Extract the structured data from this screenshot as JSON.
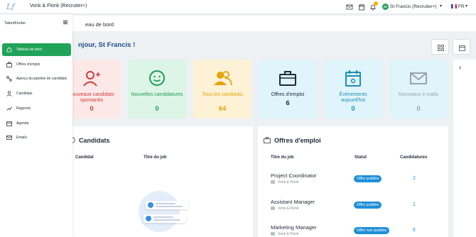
{
  "topbar": {
    "logo": "Lf",
    "company": "Vonk & Flonk (Recruiter+)",
    "notif_count": "10",
    "avatar_initials": "SF",
    "user": "St Francis (Recruiter+)",
    "lang": "FR",
    "icons": [
      "mail-icon",
      "calendar-icon",
      "bell-icon",
      "chevron-down-icon"
    ]
  },
  "sidebar": {
    "brand": "TalentFinder",
    "items": [
      {
        "label": "Tableau de bord",
        "icon": "home-icon",
        "active": true
      },
      {
        "label": "Offres d'emploi",
        "icon": "briefcase-icon",
        "active": false
      },
      {
        "label": "Aperçu du pipeline de candidats",
        "icon": "pipeline-icon",
        "active": false
      },
      {
        "label": "Candidats",
        "icon": "users-icon",
        "active": false
      },
      {
        "label": "Rapports",
        "icon": "chart-icon",
        "active": false
      },
      {
        "label": "Agenda",
        "icon": "calendar-icon",
        "active": false
      },
      {
        "label": "Emails",
        "icon": "mail-icon",
        "active": false
      }
    ]
  },
  "page": {
    "title": "eau de bord",
    "welcome": "njour, St Francis !"
  },
  "stats": [
    {
      "label": "Nouveaux candidats spontanés",
      "value": "0",
      "icon": "user-plus-icon",
      "color": "#d23b3b",
      "bg": "#fde8e8"
    },
    {
      "label": "Nouvelles candidatures",
      "value": "0",
      "icon": "smiley-icon",
      "color": "#1f9a55",
      "bg": "#dcf5e7"
    },
    {
      "label": "Tous les candidats",
      "value": "64",
      "icon": "users-icon",
      "color": "#e5a50a",
      "bg": "#fdf1d6"
    },
    {
      "label": "Offres d'emploi",
      "value": "6",
      "icon": "briefcase-icon",
      "color": "#1f2a37",
      "bg": "#dff4fb"
    },
    {
      "label": "Événements aujourd'hui",
      "value": "0",
      "icon": "calendar-icon",
      "color": "#1e8fb0",
      "bg": "#dff4fb"
    },
    {
      "label": "Nouveaux e-mails",
      "value": "0",
      "icon": "mail-icon",
      "color": "#9aa3ad",
      "bg": "#dff4fb"
    }
  ],
  "candidates_panel": {
    "title": "Candidats",
    "col_candidate": "Candidat",
    "col_job": "Titre du job"
  },
  "jobs_panel": {
    "title": "Offres d'emploi",
    "col_title": "Titre du job",
    "col_status": "Statut",
    "col_apps": "Candidatures",
    "rows": [
      {
        "title": "Project Coordinator",
        "company": "Vonk & Flonk",
        "status": "Offre publiée",
        "count": "2"
      },
      {
        "title": "Assistant Manager",
        "company": "Vonk & Flonk",
        "status": "Offre publiée",
        "count": "1"
      },
      {
        "title": "Marketing Manager",
        "company": "Vonk & Flonk",
        "status": "Offre non publiée",
        "count": "6"
      }
    ]
  }
}
